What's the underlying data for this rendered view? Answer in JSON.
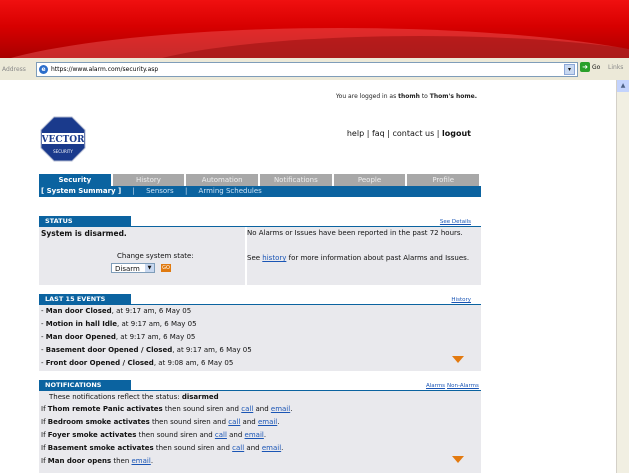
{
  "browser": {
    "address_label": "Address",
    "url": "https://www.alarm.com/security.asp",
    "go_label": "Go",
    "links_label": "Links"
  },
  "header": {
    "logged_in_prefix": "You are logged in as ",
    "user": "thomh",
    "to": " to ",
    "home": "Thom's home.",
    "logo_text": "VECTOR",
    "logo_sub": "SECURITY",
    "help": "help",
    "faq": "faq",
    "contact": "contact us",
    "logout": "logout",
    "sep": " | "
  },
  "tabs": [
    {
      "label": "Security"
    },
    {
      "label": "History"
    },
    {
      "label": "Automation"
    },
    {
      "label": "Notifications"
    },
    {
      "label": "People"
    },
    {
      "label": "Profile"
    }
  ],
  "subnav": {
    "summary": "[ System Summary ]",
    "sep": "|",
    "sensors": "Sensors",
    "arming": "Arming Schedules"
  },
  "status": {
    "title": "STATUS",
    "see_details": "See Details",
    "system_state": "System is disarmed.",
    "change_label": "Change system state:",
    "selected": "Disarm",
    "go": "GO",
    "no_alarms": "No Alarms or Issues have been reported in the past 72 hours.",
    "see_prefix": "See ",
    "history_link": "history",
    "see_suffix": " for more information about past Alarms and Issues."
  },
  "events": {
    "title": "LAST 15 EVENTS",
    "history_link": "History",
    "items": [
      {
        "bold": "Man door Closed",
        "rest": ", at 9:17 am, 6 May 05"
      },
      {
        "bold": "Motion in hall Idle",
        "rest": ", at 9:17 am, 6 May 05"
      },
      {
        "bold": "Man door Opened",
        "rest": ", at 9:17 am, 6 May 05"
      },
      {
        "bold": "Basement door Opened / Closed",
        "rest": ", at 9:17 am, 6 May 05"
      },
      {
        "bold": "Front door Opened / Closed",
        "rest": ", at 9:08 am, 6 May 05"
      }
    ]
  },
  "notifications": {
    "title": "NOTIFICATIONS",
    "alarms_link": "Alarms",
    "non_alarms_link": "Non-Alarms",
    "intro": "These notifications reflect the status: ",
    "intro_status": "disarmed",
    "if": "If ",
    "then": " then sound siren and ",
    "and": " and ",
    "period": ".",
    "call": "call",
    "email": "email",
    "then_only": " then ",
    "items": [
      "Thom remote Panic activates",
      "Bedroom smoke activates",
      "Foyer smoke activates",
      "Basement smoke activates"
    ],
    "last_item": "Man door opens"
  }
}
